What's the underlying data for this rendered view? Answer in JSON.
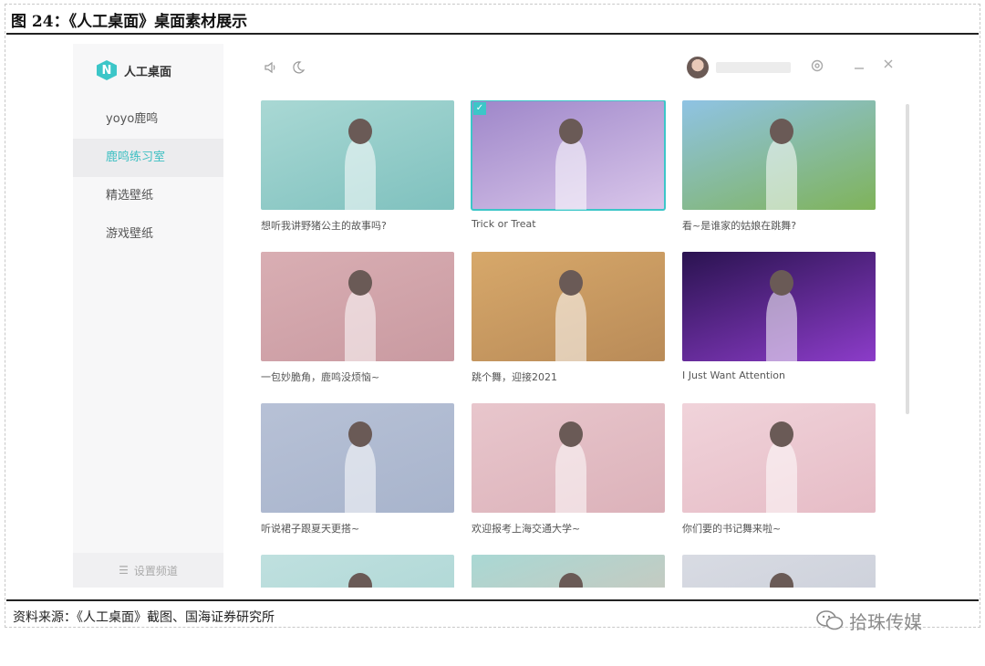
{
  "report": {
    "figure_title": "图 24：《人工桌面》桌面素材展示",
    "source": "资料来源：《人工桌面》截图、国海证券研究所",
    "watermark": "拾珠传媒"
  },
  "app": {
    "logo_letter": "N",
    "name": "人工桌面",
    "accent": "#3cc6c8",
    "sidebar": {
      "items": [
        {
          "label": "yoyo鹿鸣",
          "active": false
        },
        {
          "label": "鹿鸣练习室",
          "active": true
        },
        {
          "label": "精选壁纸",
          "active": false
        },
        {
          "label": "游戏壁纸",
          "active": false
        }
      ],
      "footer_label": "设置频道"
    },
    "topbar": {
      "volume_icon": "speaker-icon",
      "theme_icon": "moon-icon",
      "settings_icon": "gear-icon",
      "minimize_icon": "minus-icon",
      "close_icon": "x-icon"
    },
    "wallpapers": [
      {
        "caption": "想听我讲野猪公主的故事吗?",
        "bg": [
          "#a9d8d4",
          "#7fc1be"
        ],
        "selected": false
      },
      {
        "caption": "Trick or Treat",
        "bg": [
          "#9e86c9",
          "#d9c6ea"
        ],
        "selected": true
      },
      {
        "caption": "看~是谁家的姑娘在跳舞?",
        "bg": [
          "#8fc3e4",
          "#7fb35a"
        ],
        "selected": false
      },
      {
        "caption": "一包妙脆角，鹿鸣没烦恼~",
        "bg": [
          "#d9aeb3",
          "#c99aa1"
        ],
        "selected": false
      },
      {
        "caption": "跳个舞，迎接2021",
        "bg": [
          "#d7a86a",
          "#b98b58"
        ],
        "selected": false
      },
      {
        "caption": "I Just Want Attention",
        "bg": [
          "#2a1350",
          "#8c3cc9"
        ],
        "selected": false
      },
      {
        "caption": "听说裙子跟夏天更搭~",
        "bg": [
          "#b7c1d6",
          "#a8b4cc"
        ],
        "selected": false
      },
      {
        "caption": "欢迎报考上海交通大学~",
        "bg": [
          "#e8c6cc",
          "#dcb2ba"
        ],
        "selected": false
      },
      {
        "caption": "你们要的书记舞来啦~",
        "bg": [
          "#f0d3da",
          "#e6bcc6"
        ],
        "selected": false
      },
      {
        "caption": "",
        "bg": [
          "#bfe0df",
          "#a9d4d2"
        ],
        "selected": false
      },
      {
        "caption": "",
        "bg": [
          "#a9d8d4",
          "#d8c1b4"
        ],
        "selected": false
      },
      {
        "caption": "",
        "bg": [
          "#d8dbe3",
          "#c7cbd6"
        ],
        "selected": false
      }
    ]
  }
}
